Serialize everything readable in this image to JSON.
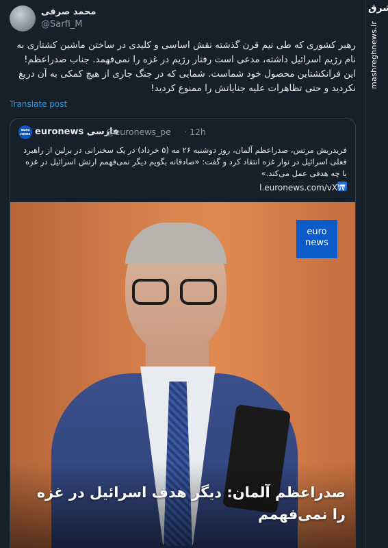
{
  "tweet": {
    "display_name": "محمد صرفی",
    "handle": "@Sarfi_M",
    "text": "رهبر کشوری که طی نیم قرن گذشته نقش اساسی و کلیدی در ساختن ماشین کشتاری به نام رژیم اسرائیل داشته، مدعی است رفتار رژیم در غزه را نمی‌فهمد. جناب صدراعظم! این فرانکشتاین محصول خود شماست. شمایی که در جنگ جاری از هیچ کمکی به آن دریغ نکردید و حتی تظاهرات علیه جنایاتش را ممنوع کردید!",
    "translate_label": "Translate post"
  },
  "quote": {
    "logo_text": "euro news",
    "name": "euronews فارسی",
    "handle": "@euronews_pe",
    "separator": "·",
    "time": "12h",
    "text": "فریدریش مرتس، صدراعظم آلمان، روز دوشنبه ۲۶ مه (۵ خرداد) در یک سخنرانی در برلین از راهبرد فعلی اسرائیل در نوار غزه انتقاد کرد و گفت: «صادقانه بگویم دیگر نمی‌فهمم ارتش اسرائیل در غزه با چه هدفی عمل می‌کند.»",
    "link": "l.euronews.com/vXW",
    "arrow_icon": "➡",
    "media": {
      "brand_logo": "euro news",
      "caption": "صدراعظم آلمان: دیگر هدف اسرائیل در غزه را نمی‌فهمم"
    }
  },
  "watermark": {
    "logo": "مشرق",
    "site": "mashreghnews.ir"
  }
}
